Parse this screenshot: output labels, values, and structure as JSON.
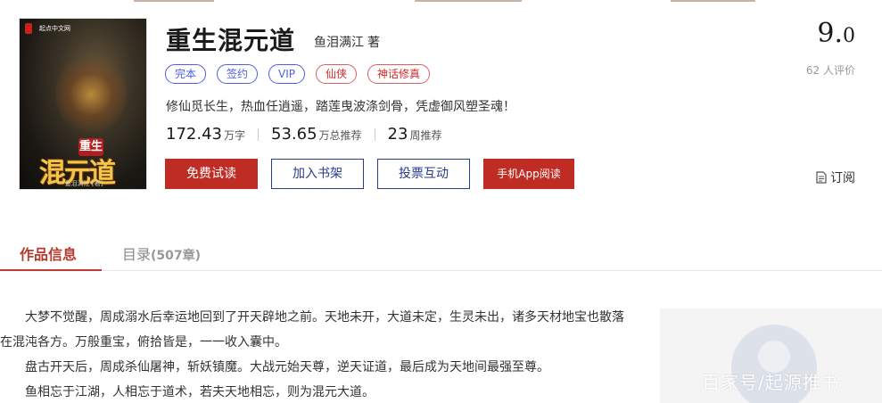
{
  "book": {
    "title": "重生混元道",
    "author": "鱼泪满江",
    "author_suffix": "著",
    "tags": [
      {
        "label": "完本",
        "style": "blue"
      },
      {
        "label": "签约",
        "style": "blue"
      },
      {
        "label": "VIP",
        "style": "blue"
      },
      {
        "label": "仙侠",
        "style": "red"
      },
      {
        "label": "神话修真",
        "style": "red"
      }
    ],
    "intro": "修仙觅长生，热血任逍遥，踏莲曳波涤剑骨，凭虚御风塑圣魂！",
    "stats": [
      {
        "num": "172.43",
        "unit": "万字"
      },
      {
        "num": "53.65",
        "unit": "万总推荐"
      },
      {
        "num": "23",
        "unit": "周推荐"
      }
    ]
  },
  "cover": {
    "publisher": "起点中文网",
    "seal_text": "重生",
    "title_text": "混元道",
    "author_text": "鱼泪满江 [著]"
  },
  "buttons": {
    "read": "免费试读",
    "shelf": "加入书架",
    "vote": "投票互动",
    "app": "手机App阅读"
  },
  "score": {
    "integer": "9.",
    "decimal": "0",
    "raters": "62 人评价"
  },
  "subscribe": {
    "label": "订阅",
    "icon": "document-icon"
  },
  "tabs": {
    "info": "作品信息",
    "catalog": "目录",
    "catalog_count": "(507章)"
  },
  "description": [
    "大梦不觉醒，周成溺水后幸运地回到了开天辟地之前。天地未开，大道未定，生灵未出，诸多天材地宝也散落",
    "在混沌各方。万般重宝，俯拾皆是，一一收入囊中。",
    "盘古开天后，周成杀仙屠神，斩妖镇魔。大战元始天尊，逆天证道，最后成为天地间最强至尊。",
    "鱼相忘于江湖，人相忘于道术，若夫天地相忘，则为混元大道。"
  ],
  "watermark": "百家号/起源推书",
  "colors": {
    "accent_red": "#bf2c24",
    "outline_blue": "#2a3b8f",
    "tag_blue": "#4c5fe0",
    "tag_red": "#d02a2a"
  }
}
